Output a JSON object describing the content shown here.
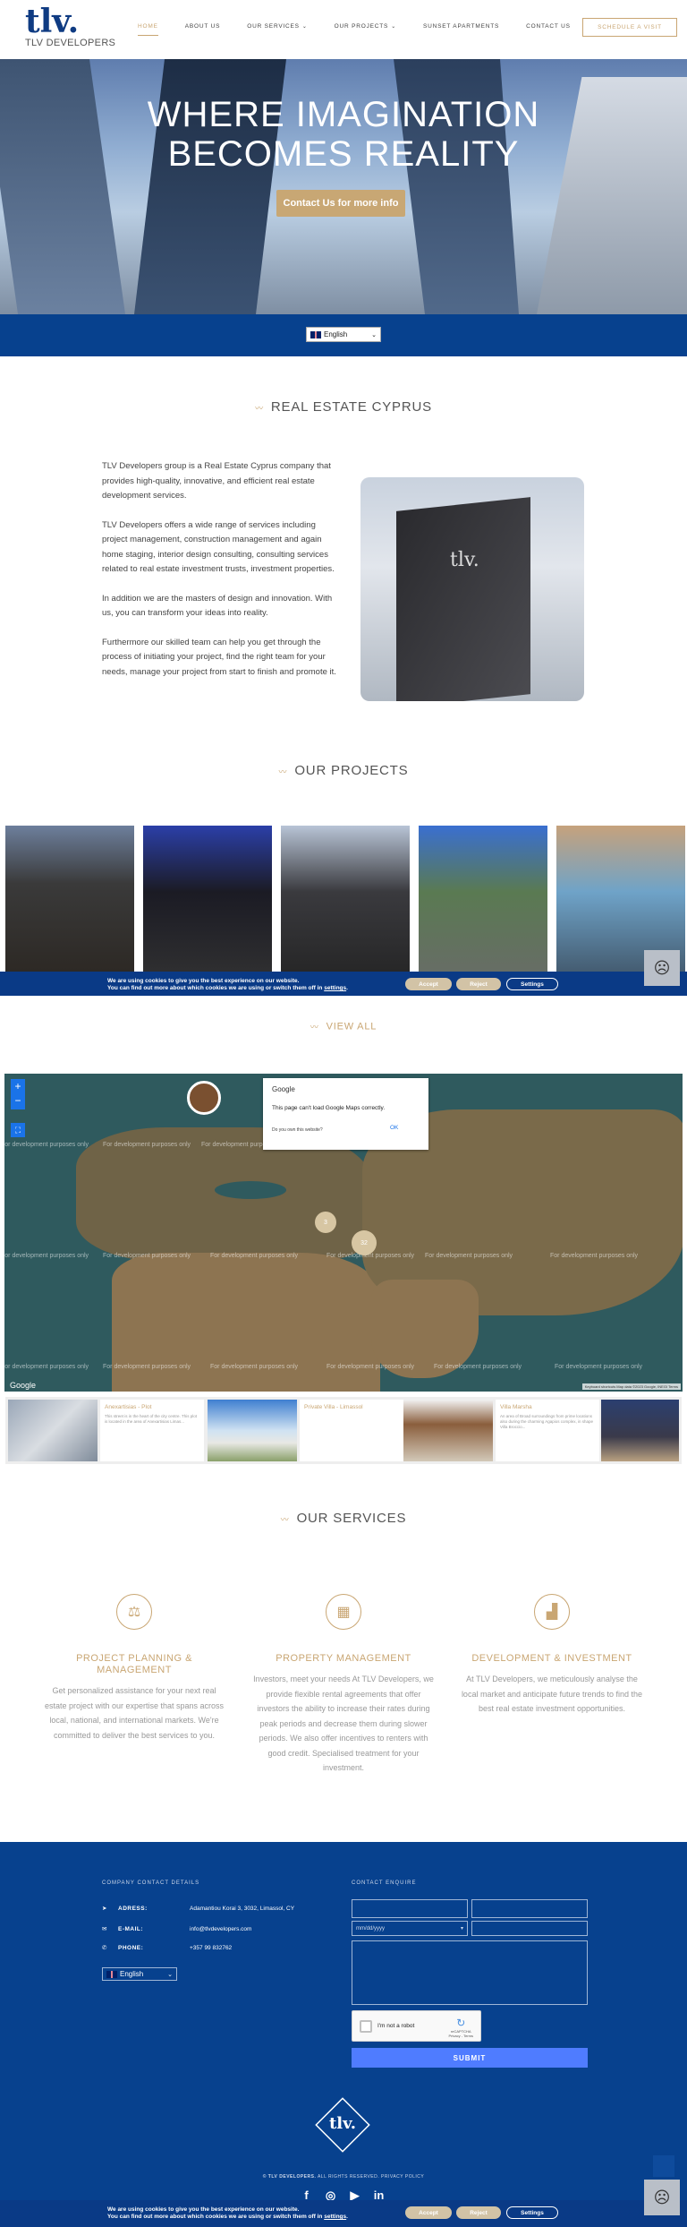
{
  "header": {
    "logo_mark": "tlv.",
    "logo_sub": "TLV DEVELOPERS",
    "nav": [
      {
        "label": "HOME",
        "active": true,
        "dropdown": false
      },
      {
        "label": "ABOUT US",
        "active": false,
        "dropdown": false
      },
      {
        "label": "OUR SERVICES",
        "active": false,
        "dropdown": true
      },
      {
        "label": "OUR PROJECTS",
        "active": false,
        "dropdown": true
      },
      {
        "label": "SUNSET APARTMENTS",
        "active": false,
        "dropdown": false
      },
      {
        "label": "CONTACT US",
        "active": false,
        "dropdown": false
      }
    ],
    "cta": "SCHEDULE A VISIT"
  },
  "hero": {
    "title_line1": "WHERE IMAGINATION",
    "title_line2": "BECOMES REALITY",
    "button": "Contact Us for more info"
  },
  "language": {
    "selected": "English"
  },
  "about": {
    "heading": "REAL ESTATE CYPRUS",
    "paragraphs": [
      "TLV Developers group is a Real Estate Cyprus company that provides high-quality, innovative, and efficient real estate development services.",
      "TLV Developers offers a wide range of services including project management, construction management and again home staging, interior design consulting, consulting services related to real estate investment trusts, investment properties.",
      "In addition we are the masters of design and innovation. With us, you can transform your ideas into reality.",
      "Furthermore our skilled team can help you get through the process of initiating your project, find the right team for your needs, manage your project from start to finish and promote it."
    ]
  },
  "projects": {
    "heading": "OUR PROJECTS",
    "view_all": "VIEW ALL"
  },
  "cookie": {
    "line1": "We are using cookies to give you the best experience on our website.",
    "line2_prefix": "You can find out more about which cookies we are using or switch them off in ",
    "line2_link": "settings",
    "line2_suffix": ".",
    "accept": "Accept",
    "reject": "Reject",
    "settings": "Settings"
  },
  "map": {
    "watermark": "For development purposes only",
    "zoom_in": "+",
    "zoom_out": "−",
    "dialog_brand": "Google",
    "dialog_message": "This page can't load Google Maps correctly.",
    "dialog_question": "Do you own this website?",
    "dialog_ok": "OK",
    "clusters": [
      "3",
      "32"
    ],
    "google_label": "Google",
    "attribution": "Keyboard shortcuts  Map data ©2023 Google, INEGI  Terms"
  },
  "listings": [
    {
      "title": "Anexartisias - Plot",
      "desc": "This street is in the heart of the city centre. This plot is located in the area of Anexartisias Limas..."
    },
    {
      "title": "Private Villa - Limassol",
      "desc": ""
    },
    {
      "title": "Villa Marsha",
      "desc": "An area of Broad surroundings from prime locations also during the charming Agapios complex, in shape Villa Broccio..."
    }
  ],
  "services": {
    "heading": "OUR SERVICES",
    "items": [
      {
        "icon": "scales-icon",
        "title": "PROJECT PLANNING & MANAGEMENT",
        "desc": "Get personalized assistance for your next real estate project with our expertise that spans across local, national, and international markets. We're committed to deliver the best services to you."
      },
      {
        "icon": "building-icon",
        "title": "PROPERTY MANAGEMENT",
        "desc": "Investors, meet your needs At TLV Developers, we provide flexible rental agreements that offer investors the ability to increase their rates during peak periods and decrease them during slower periods. We also offer incentives to renters with good credit. Specialised treatment for your investment."
      },
      {
        "icon": "chart-icon",
        "title": "DEVELOPMENT & INVESTMENT",
        "desc": "At TLV Developers, we meticulously analyse the local market and anticipate future trends to find the best real estate investment opportunities."
      }
    ]
  },
  "footer": {
    "company_label": "COMPANY CONTACT DETAILS",
    "contact_label": "CONTACT ENQUIRE",
    "address_key": "ADRESS:",
    "address": "Adamantiou Korai 3, 3032, Limassol, CY",
    "email_key": "E-MAIL:",
    "email": "info@tlvdevelopers.com",
    "phone_key": "PHONE:",
    "phone": "+357 99 832762",
    "language": "English",
    "date_placeholder": "mm/dd/yyyy",
    "captcha_text": "I'm not a robot",
    "captcha_brand": "reCAPTCHA",
    "captcha_links": "Privacy - Terms",
    "submit": "SUBMIT",
    "logo_text": "tlv.",
    "copyright_bold": "© TLV DEVELOPERS.",
    "copyright_rest": " ALL RIGHTS RESERVED. PRIVACY POLICY",
    "social": [
      {
        "icon": "facebook-icon",
        "glyph": "f"
      },
      {
        "icon": "instagram-icon",
        "glyph": "◎"
      },
      {
        "icon": "youtube-icon",
        "glyph": "▶"
      },
      {
        "icon": "linkedin-icon",
        "glyph": "in"
      }
    ]
  },
  "colors": {
    "brand_blue": "#07418e",
    "gold": "#c9a673",
    "submit_blue": "#4f7cff"
  }
}
